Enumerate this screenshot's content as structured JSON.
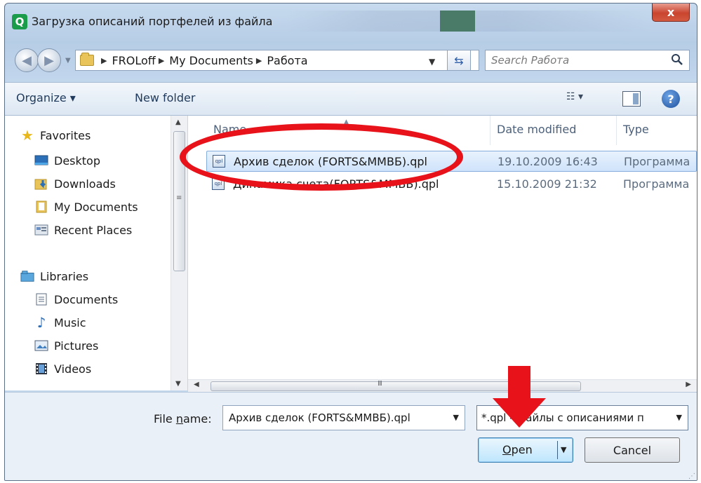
{
  "window": {
    "title": "Загрузка описаний портфелей из файла",
    "app_icon_letter": "Q",
    "close_label": "x"
  },
  "address": {
    "breadcrumbs": [
      "FROLoff",
      "My Documents",
      "Работа"
    ],
    "search_placeholder": "Search Работа"
  },
  "toolbar": {
    "organize_label": "Organize ▾",
    "new_folder_label": "New folder"
  },
  "navigation": {
    "favorites_label": "Favorites",
    "favorites": [
      "Desktop",
      "Downloads",
      "My Documents",
      "Recent Places"
    ],
    "libraries_label": "Libraries",
    "libraries": [
      "Documents",
      "Music",
      "Pictures",
      "Videos"
    ]
  },
  "files": {
    "columns": [
      "Name",
      "Date modified",
      "Type"
    ],
    "rows": [
      {
        "name": "Архив сделок (FORTS&MMBБ).qpl",
        "date": "19.10.2009 16:43",
        "type": "Программа"
      },
      {
        "name": "Динамика счета(FORTS&MMBБ).qpl",
        "date": "15.10.2009 21:32",
        "type": "Программа"
      }
    ],
    "scroll_grip": "III"
  },
  "bottom": {
    "file_name_label_prefix": "File ",
    "file_name_label_underlined": "n",
    "file_name_label_suffix": "ame:",
    "file_name_value": "Архив сделок (FORTS&MMBБ).qpl",
    "filter_value": "*.qpl - файлы с описаниями п",
    "open_label_underlined": "O",
    "open_label_rest": "pen",
    "cancel_label": "Cancel"
  },
  "colors": {
    "annotation_red": "#e8121a",
    "selection_blue": "#cfe3fb"
  }
}
